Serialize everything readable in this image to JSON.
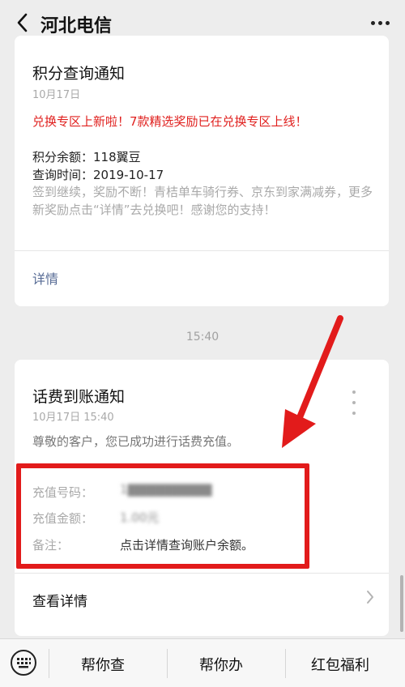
{
  "header": {
    "title": "河北电信"
  },
  "card1": {
    "title": "积分查询通知",
    "date": "10月17日",
    "promo": "兑换专区上新啦！7款精选奖励已在兑换专区上线！",
    "balance": "积分余额：118翼豆",
    "query_time": "查询时间：2019-10-17",
    "note": "签到继续，奖励不断！青桔单车骑行券、京东到家满减券，更多新奖励点击“详情”去兑换吧！感谢您的支持！",
    "detail": "详情"
  },
  "timestamp": "15:40",
  "card2": {
    "title": "话费到账通知",
    "date": "10月17日  15:40",
    "message": "尊敬的客户，您已成功进行话费充值。",
    "rows": [
      {
        "label": "充值号码：",
        "value": "1▇▇▇▇▇▇▇▇▇"
      },
      {
        "label": "充值金额：",
        "value": "1.00元"
      },
      {
        "label": "备注：",
        "value": "点击详情查询账户余额。"
      }
    ],
    "view_detail": "查看详情"
  },
  "toolbar": {
    "items": [
      "帮你查",
      "帮你办",
      "红包福利"
    ]
  },
  "colors": {
    "accent_red": "#e21b1b",
    "link_blue": "#576b95"
  }
}
